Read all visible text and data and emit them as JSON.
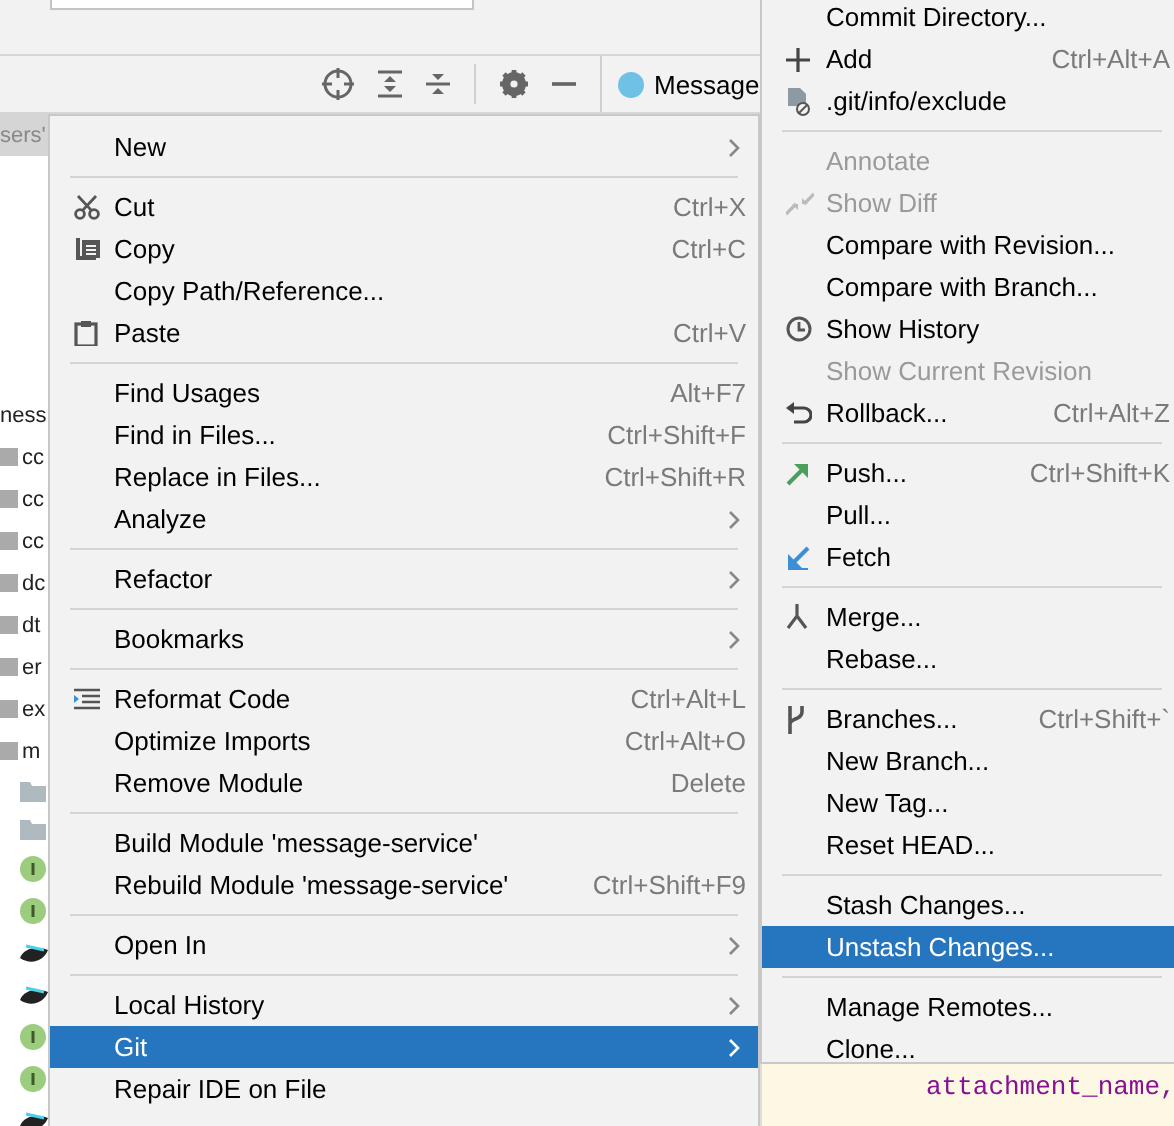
{
  "toolbar": {
    "tab_label": "Message"
  },
  "project_tree": {
    "items": [
      {
        "label": "sers'",
        "selected": true
      },
      {
        "label": "ness",
        "selected": false
      },
      {
        "label": "cc",
        "selected": false
      },
      {
        "label": "cc",
        "selected": false
      },
      {
        "label": "cc",
        "selected": false
      },
      {
        "label": "dc",
        "selected": false
      },
      {
        "label": "dt",
        "selected": false
      },
      {
        "label": "er",
        "selected": false
      },
      {
        "label": "ex",
        "selected": false
      },
      {
        "label": "m",
        "selected": false
      }
    ]
  },
  "context_menu": {
    "groups": [
      [
        {
          "label": "New",
          "submenu": true,
          "selected": false,
          "disabled": false
        }
      ],
      [
        {
          "label": "Cut",
          "shortcut": "Ctrl+X",
          "submenu": false,
          "selected": false,
          "disabled": false
        },
        {
          "label": "Copy",
          "shortcut": "Ctrl+C",
          "submenu": false,
          "selected": false,
          "disabled": false
        },
        {
          "label": "Copy Path/Reference...",
          "submenu": false,
          "selected": false,
          "disabled": false
        },
        {
          "label": "Paste",
          "shortcut": "Ctrl+V",
          "submenu": false,
          "selected": false,
          "disabled": false
        }
      ],
      [
        {
          "label": "Find Usages",
          "shortcut": "Alt+F7",
          "submenu": false,
          "selected": false,
          "disabled": false
        },
        {
          "label": "Find in Files...",
          "shortcut": "Ctrl+Shift+F",
          "submenu": false,
          "selected": false,
          "disabled": false
        },
        {
          "label": "Replace in Files...",
          "shortcut": "Ctrl+Shift+R",
          "submenu": false,
          "selected": false,
          "disabled": false
        },
        {
          "label": "Analyze",
          "submenu": true,
          "selected": false,
          "disabled": false
        }
      ],
      [
        {
          "label": "Refactor",
          "submenu": true,
          "selected": false,
          "disabled": false
        }
      ],
      [
        {
          "label": "Bookmarks",
          "submenu": true,
          "selected": false,
          "disabled": false
        }
      ],
      [
        {
          "label": "Reformat Code",
          "shortcut": "Ctrl+Alt+L",
          "submenu": false,
          "selected": false,
          "disabled": false
        },
        {
          "label": "Optimize Imports",
          "shortcut": "Ctrl+Alt+O",
          "submenu": false,
          "selected": false,
          "disabled": false
        },
        {
          "label": "Remove Module",
          "shortcut": "Delete",
          "submenu": false,
          "selected": false,
          "disabled": false
        }
      ],
      [
        {
          "label": "Build Module 'message-service'",
          "submenu": false,
          "selected": false,
          "disabled": false
        },
        {
          "label": "Rebuild Module 'message-service'",
          "shortcut": "Ctrl+Shift+F9",
          "submenu": false,
          "selected": false,
          "disabled": false
        }
      ],
      [
        {
          "label": "Open In",
          "submenu": true,
          "selected": false,
          "disabled": false
        }
      ],
      [
        {
          "label": "Local History",
          "submenu": true,
          "selected": false,
          "disabled": false
        },
        {
          "label": "Git",
          "submenu": true,
          "selected": true,
          "disabled": false
        },
        {
          "label": "Repair IDE on File",
          "submenu": false,
          "selected": false,
          "disabled": false
        }
      ]
    ]
  },
  "git_submenu": {
    "groups": [
      [
        {
          "label": "Commit Directory...",
          "submenu": false,
          "selected": false,
          "disabled": false
        },
        {
          "label": "Add",
          "shortcut": "Ctrl+Alt+A",
          "submenu": false,
          "selected": false,
          "disabled": false
        },
        {
          "label": ".git/info/exclude",
          "submenu": false,
          "selected": false,
          "disabled": false
        }
      ],
      [
        {
          "label": "Annotate",
          "submenu": false,
          "selected": false,
          "disabled": true
        },
        {
          "label": "Show Diff",
          "submenu": false,
          "selected": false,
          "disabled": true
        },
        {
          "label": "Compare with Revision...",
          "submenu": false,
          "selected": false,
          "disabled": false
        },
        {
          "label": "Compare with Branch...",
          "submenu": false,
          "selected": false,
          "disabled": false
        },
        {
          "label": "Show History",
          "submenu": false,
          "selected": false,
          "disabled": false
        },
        {
          "label": "Show Current Revision",
          "submenu": false,
          "selected": false,
          "disabled": true
        },
        {
          "label": "Rollback...",
          "shortcut": "Ctrl+Alt+Z",
          "submenu": false,
          "selected": false,
          "disabled": false
        }
      ],
      [
        {
          "label": "Push...",
          "shortcut": "Ctrl+Shift+K",
          "submenu": false,
          "selected": false,
          "disabled": false
        },
        {
          "label": "Pull...",
          "submenu": false,
          "selected": false,
          "disabled": false
        },
        {
          "label": "Fetch",
          "submenu": false,
          "selected": false,
          "disabled": false
        }
      ],
      [
        {
          "label": "Merge...",
          "submenu": false,
          "selected": false,
          "disabled": false
        },
        {
          "label": "Rebase...",
          "submenu": false,
          "selected": false,
          "disabled": false
        }
      ],
      [
        {
          "label": "Branches...",
          "shortcut": "Ctrl+Shift+`",
          "submenu": false,
          "selected": false,
          "disabled": false
        },
        {
          "label": "New Branch...",
          "submenu": false,
          "selected": false,
          "disabled": false
        },
        {
          "label": "New Tag...",
          "submenu": false,
          "selected": false,
          "disabled": false
        },
        {
          "label": "Reset HEAD...",
          "submenu": false,
          "selected": false,
          "disabled": false
        }
      ],
      [
        {
          "label": "Stash Changes...",
          "submenu": false,
          "selected": false,
          "disabled": false
        },
        {
          "label": "Unstash Changes...",
          "submenu": false,
          "selected": true,
          "disabled": false
        }
      ],
      [
        {
          "label": "Manage Remotes...",
          "submenu": false,
          "selected": false,
          "disabled": false
        },
        {
          "label": "Clone...",
          "submenu": false,
          "selected": false,
          "disabled": false
        }
      ]
    ]
  },
  "editor": {
    "code": "attachment_name,"
  }
}
